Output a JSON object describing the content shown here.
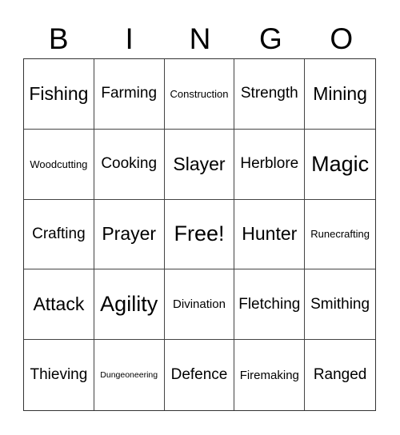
{
  "header": {
    "letters": [
      "B",
      "I",
      "N",
      "G",
      "O"
    ]
  },
  "cells": [
    {
      "text": "Fishing",
      "size": "s-l"
    },
    {
      "text": "Farming",
      "size": "s-m"
    },
    {
      "text": "Construction",
      "size": "s-xs"
    },
    {
      "text": "Strength",
      "size": "s-m"
    },
    {
      "text": "Mining",
      "size": "s-l"
    },
    {
      "text": "Woodcutting",
      "size": "s-xs"
    },
    {
      "text": "Cooking",
      "size": "s-m"
    },
    {
      "text": "Slayer",
      "size": "s-l"
    },
    {
      "text": "Herblore",
      "size": "s-m"
    },
    {
      "text": "Magic",
      "size": "s-xl"
    },
    {
      "text": "Crafting",
      "size": "s-m"
    },
    {
      "text": "Prayer",
      "size": "s-l"
    },
    {
      "text": "Free!",
      "size": "s-xl"
    },
    {
      "text": "Hunter",
      "size": "s-l"
    },
    {
      "text": "Runecrafting",
      "size": "s-xs"
    },
    {
      "text": "Attack",
      "size": "s-l"
    },
    {
      "text": "Agility",
      "size": "s-xl"
    },
    {
      "text": "Divination",
      "size": "s-s"
    },
    {
      "text": "Fletching",
      "size": "s-m"
    },
    {
      "text": "Smithing",
      "size": "s-m"
    },
    {
      "text": "Thieving",
      "size": "s-m"
    },
    {
      "text": "Dungeoneering",
      "size": "s-xxs"
    },
    {
      "text": "Defence",
      "size": "s-m"
    },
    {
      "text": "Firemaking",
      "size": "s-s"
    },
    {
      "text": "Ranged",
      "size": "s-m"
    }
  ]
}
